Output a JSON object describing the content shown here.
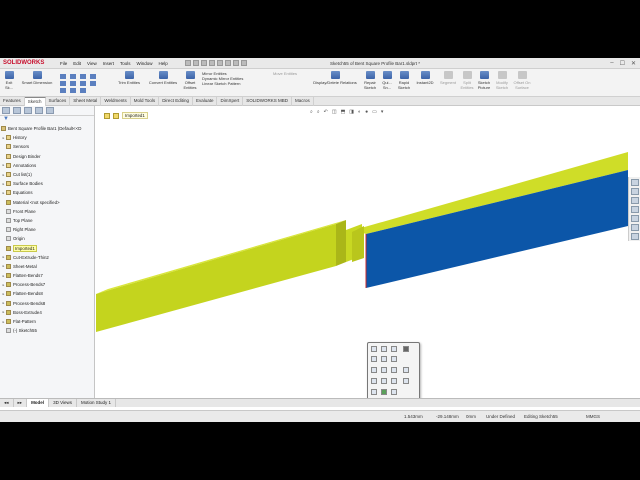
{
  "app": {
    "logo_text": "SOLIDWORKS",
    "document_title": "Sketch55 of Bent Square Profile Bar1.sldprt *"
  },
  "menu": [
    "File",
    "Edit",
    "View",
    "Insert",
    "Tools",
    "Window",
    "Help"
  ],
  "window_controls": [
    "–",
    "☐",
    "✕"
  ],
  "ribbon": {
    "exit_sketch": "Exit Sk...",
    "smart_dimension": "Smart Dimension",
    "trim_entities": "Trim Entities",
    "convert_entities": "Convert Entities",
    "offset_entities": "Offset Entities",
    "mirror_entities": "Mirror Entities",
    "dynamic_mirror": "Dynamic Mirror Entities",
    "linear_pattern": "Linear Sketch Pattern",
    "move_entities": "Move Entities",
    "display_delete_relations": "Display/Delete Relations",
    "repair_sketch": "Repair Sketch",
    "quick_snaps": "Qui... Sn...",
    "rapid_sketch": "Rapid Sketch",
    "instant2d": "Instant2D",
    "segment": "Segment",
    "split_entities": "Split Entities",
    "sketch_picture": "Sketch Picture",
    "modify_sketch": "Modify Sketch",
    "offset_on_surface": "Offset On Surface"
  },
  "tabs": [
    "Features",
    "Sketch",
    "Surfaces",
    "Sheet Metal",
    "Weldments",
    "Mold Tools",
    "Direct Editing",
    "Evaluate",
    "DimXpert",
    "SOLIDWORKS MBD",
    "Macros"
  ],
  "active_tab": "Sketch",
  "tree": {
    "root": "Bent Square Profile Bar1  (Default<<D",
    "items": [
      {
        "label": "History",
        "kind": "folder",
        "arrow": "▸"
      },
      {
        "label": "Sensors",
        "kind": "folder",
        "arrow": ""
      },
      {
        "label": "Design Binder",
        "kind": "folder",
        "arrow": ""
      },
      {
        "label": "Annotations",
        "kind": "folder",
        "arrow": "▸"
      },
      {
        "label": "Cut list(1)",
        "kind": "folder",
        "arrow": "▸"
      },
      {
        "label": "Surface Bodies",
        "kind": "folder",
        "arrow": "▸"
      },
      {
        "label": "Equations",
        "kind": "folder",
        "arrow": "▸"
      },
      {
        "label": "Material <not specified>",
        "kind": "feat",
        "arrow": ""
      },
      {
        "label": "Front Plane",
        "kind": "plane",
        "arrow": ""
      },
      {
        "label": "Top Plane",
        "kind": "plane",
        "arrow": ""
      },
      {
        "label": "Right Plane",
        "kind": "plane",
        "arrow": ""
      },
      {
        "label": "Origin",
        "kind": "plane",
        "arrow": ""
      },
      {
        "label": "Imported1",
        "kind": "feat",
        "arrow": "",
        "highlight": true
      },
      {
        "label": "Cut-Extrude-Thin2",
        "kind": "feat",
        "arrow": "▸"
      },
      {
        "label": "Sheet-Metal",
        "kind": "feat",
        "arrow": "▸"
      },
      {
        "label": "Flatten-Bends7",
        "kind": "feat",
        "arrow": "▸"
      },
      {
        "label": "Process-Bends7",
        "kind": "feat",
        "arrow": "▸"
      },
      {
        "label": "Flatten-Bends8",
        "kind": "feat",
        "arrow": "▸"
      },
      {
        "label": "Process-Bends8",
        "kind": "feat",
        "arrow": "▸"
      },
      {
        "label": "Boss-Extrude4",
        "kind": "feat",
        "arrow": "▸"
      },
      {
        "label": "Flat-Pattern",
        "kind": "feat",
        "arrow": "▸"
      },
      {
        "label": "(-) Sketch55",
        "kind": "plane",
        "arrow": ""
      }
    ]
  },
  "viewport": {
    "breadcrumb": "Imported1"
  },
  "bottom_tabs": [
    "Model",
    "3D Views",
    "Motion Study 1"
  ],
  "status": {
    "x": "1.543mm",
    "y": "-29.148mm",
    "z": "0mm",
    "state": "Under Defined",
    "editing": "Editing Sketch55",
    "units": "MMGS"
  },
  "colors": {
    "bar_yellow": "#c8d820",
    "bar_blue": "#0c56a8",
    "app_red": "#c8102e"
  }
}
